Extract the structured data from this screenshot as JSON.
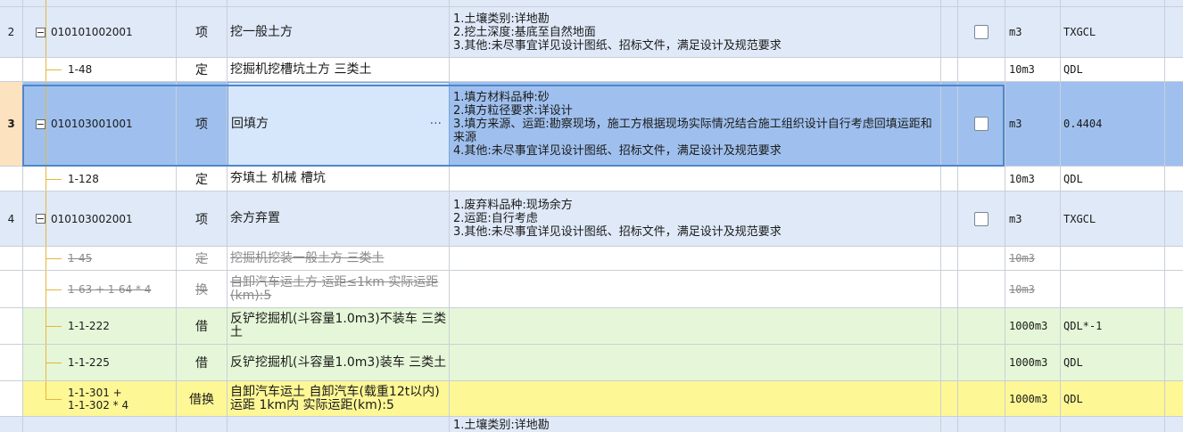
{
  "rows": [
    {
      "no": "",
      "code": "",
      "type": "",
      "name": "",
      "feature": "",
      "unit": "",
      "expr": ""
    },
    {
      "no": "2",
      "code": "010101002001",
      "type": "项",
      "name": "挖一般土方",
      "feature": "1.土壤类别:详地勘\n2.挖土深度:基底至自然地面\n3.其他:未尽事宜详见设计图纸、招标文件，满足设计及规范要求",
      "unit": "m3",
      "expr": "TXGCL"
    },
    {
      "no": "",
      "code": "1-48",
      "type": "定",
      "name": "挖掘机挖槽坑土方 三类土",
      "feature": "",
      "unit": "10m3",
      "expr": "QDL"
    },
    {
      "no": "3",
      "code": "010103001001",
      "type": "项",
      "name": "回填方",
      "feature": "1.填方材料品种:砂\n2.填方粒径要求:详设计\n3.填方来源、运距:勘察现场，施工方根据现场实际情况结合施工组织设计自行考虑回填运距和来源\n4.其他:未尽事宜详见设计图纸、招标文件，满足设计及规范要求",
      "unit": "m3",
      "expr": "0.4404",
      "ellipsis": "···"
    },
    {
      "no": "",
      "code": "1-128",
      "type": "定",
      "name": "夯填土 机械 槽坑",
      "feature": "",
      "unit": "10m3",
      "expr": "QDL"
    },
    {
      "no": "4",
      "code": "010103002001",
      "type": "项",
      "name": "余方弃置",
      "feature": "1.废弃料品种:现场余方\n2.运距:自行考虑\n3.其他:未尽事宜详见设计图纸、招标文件，满足设计及规范要求",
      "unit": "m3",
      "expr": "TXGCL"
    },
    {
      "no": "",
      "code": "1-45",
      "type": "定",
      "name": "挖掘机挖装一般土方 三类土",
      "feature": "",
      "unit": "10m3",
      "expr": ""
    },
    {
      "no": "",
      "code": "1-63 + 1-64 * 4",
      "type": "换",
      "name": "自卸汽车运土方 运距≤1km  实际运距(km):5",
      "feature": "",
      "unit": "10m3",
      "expr": ""
    },
    {
      "no": "",
      "code": "1-1-222",
      "type": "借",
      "name": "反铲挖掘机(斗容量1.0m3)不装车 三类土",
      "feature": "",
      "unit": "1000m3",
      "expr": "QDL*-1"
    },
    {
      "no": "",
      "code": "1-1-225",
      "type": "借",
      "name": "反铲挖掘机(斗容量1.0m3)装车 三类土",
      "feature": "",
      "unit": "1000m3",
      "expr": "QDL"
    },
    {
      "no": "",
      "code": "1-1-301 +\n1-1-302 * 4",
      "type": "借换",
      "name": "自卸汽车运土 自卸汽车(载重12t以内)运距 1km内  实际运距(km):5",
      "feature": "",
      "unit": "1000m3",
      "expr": "QDL"
    },
    {
      "no": "",
      "code": "",
      "type": "",
      "name": "",
      "feature": "1.土壤类别:详地勘",
      "unit": "",
      "expr": ""
    }
  ],
  "colors": {
    "item_row": "#dfe9f8",
    "selected_row": "#9fc0ee",
    "borrow_row": "#e5f7d8",
    "replace_row": "#fdf795",
    "tree_line": "#e6b63c"
  }
}
